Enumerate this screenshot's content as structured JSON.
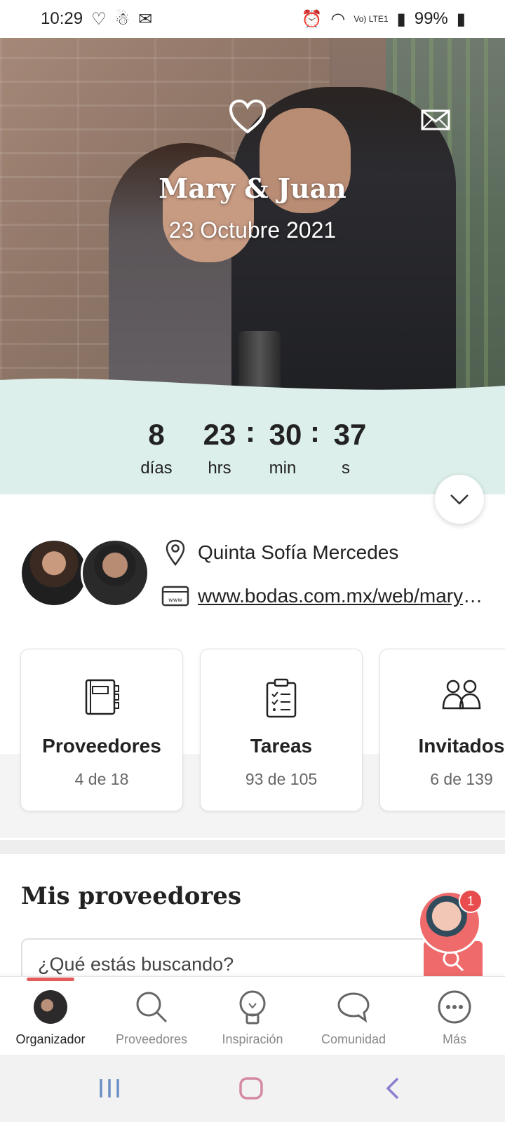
{
  "status_bar": {
    "time": "10:29",
    "network_label": "Vo) LTE1",
    "battery": "99%"
  },
  "hero": {
    "couple_name": "Mary & Juan",
    "date": "23 Octubre 2021"
  },
  "countdown": {
    "days": "8",
    "hours": "23",
    "minutes": "30",
    "seconds": "37",
    "separator": ":",
    "days_label": "días",
    "hours_label": "hrs",
    "minutes_label": "min",
    "seconds_label": "s"
  },
  "info": {
    "venue": "Quinta Sofía Mercedes",
    "website": "www.bodas.com.mx/web/mary-y-juan"
  },
  "cards": [
    {
      "title": "Proveedores",
      "count": "4 de 18"
    },
    {
      "title": "Tareas",
      "count": "93 de 105"
    },
    {
      "title": "Invitados",
      "count": "6 de 139"
    }
  ],
  "section": {
    "title": "Mis proveedores",
    "search_placeholder": "¿Qué estás buscando?"
  },
  "assistant": {
    "badge": "1"
  },
  "nav": [
    {
      "label": "Organizador"
    },
    {
      "label": "Proveedores"
    },
    {
      "label": "Inspiración"
    },
    {
      "label": "Comunidad"
    },
    {
      "label": "Más"
    }
  ],
  "colors": {
    "accent": "#e45b5b",
    "countdown_bg": "#dcefeb",
    "sys_recent": "#6b8fc4",
    "sys_home": "#d48aa0",
    "sys_back": "#8a7fd0"
  },
  "icons": [
    "heart-icon",
    "mail-icon",
    "chevron-down-icon",
    "location-pin-icon",
    "web-icon",
    "notebook-icon",
    "checklist-icon",
    "guests-icon",
    "search-icon",
    "lightbulb-icon",
    "chat-bubble-icon",
    "more-icon"
  ]
}
